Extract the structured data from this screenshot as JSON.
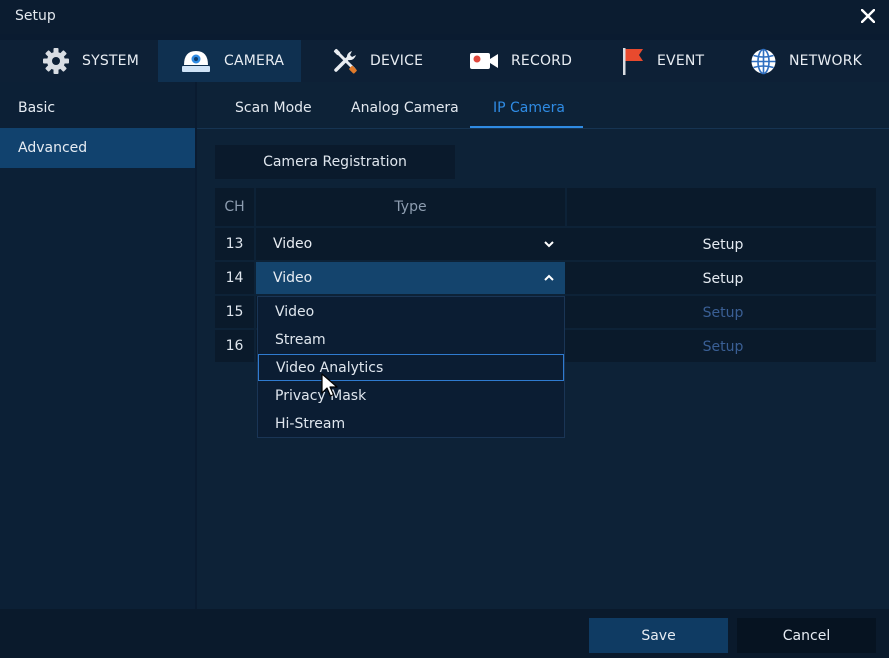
{
  "window": {
    "title": "Setup"
  },
  "nav": {
    "tabs": [
      {
        "label": "SYSTEM",
        "icon": "gear-icon"
      },
      {
        "label": "CAMERA",
        "icon": "camera-icon",
        "active": true
      },
      {
        "label": "DEVICE",
        "icon": "tools-icon"
      },
      {
        "label": "RECORD",
        "icon": "video-record-icon"
      },
      {
        "label": "EVENT",
        "icon": "flag-icon"
      },
      {
        "label": "NETWORK",
        "icon": "globe-icon"
      }
    ]
  },
  "sidebar": {
    "items": [
      {
        "label": "Basic"
      },
      {
        "label": "Advanced",
        "active": true
      }
    ]
  },
  "subtabs": [
    {
      "label": "Scan Mode"
    },
    {
      "label": "Analog Camera"
    },
    {
      "label": "IP Camera",
      "active": true
    }
  ],
  "registration": {
    "label": "Camera Registration"
  },
  "table": {
    "headers": {
      "ch": "CH",
      "type": "Type",
      "extra": ""
    },
    "rows": [
      {
        "ch": "13",
        "type": "Video",
        "setup": "Setup",
        "open": false,
        "setup_enabled": true
      },
      {
        "ch": "14",
        "type": "Video",
        "setup": "Setup",
        "open": true,
        "setup_enabled": true
      },
      {
        "ch": "15",
        "type": "",
        "setup": "Setup",
        "setup_enabled": false
      },
      {
        "ch": "16",
        "type": "",
        "setup": "Setup",
        "setup_enabled": false
      }
    ]
  },
  "dropdown": {
    "options": [
      "Video",
      "Stream",
      "Video Analytics",
      "Privacy Mask",
      "Hi-Stream"
    ],
    "highlighted": "Video Analytics"
  },
  "footer": {
    "save_label": "Save",
    "cancel_label": "Cancel"
  },
  "colors": {
    "accent": "#2f8be3",
    "background": "#0a1b30",
    "active_item": "#11426e",
    "disabled_text": "#3a5f95"
  }
}
